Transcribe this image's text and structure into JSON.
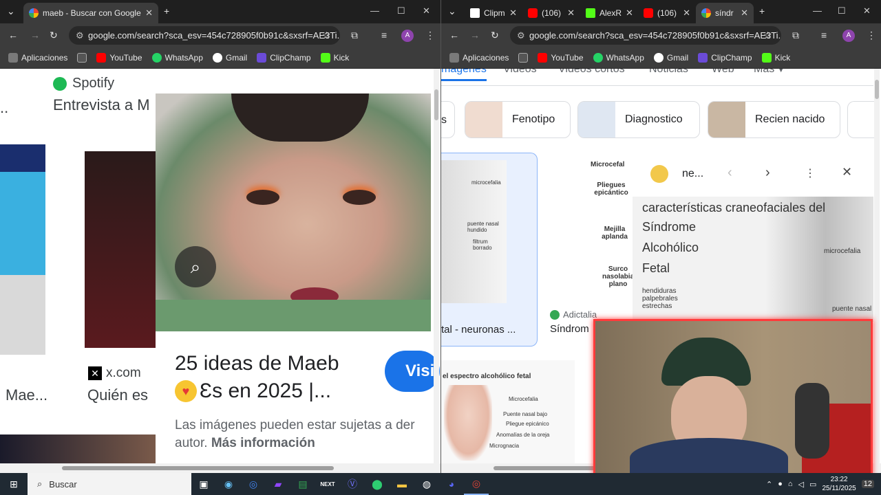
{
  "left_window": {
    "tab_title": "maeb - Buscar con Google",
    "url": "google.com/search?sca_esv=454c728905f0b91c&sxsrf=AE3Ti...",
    "bookmarks": [
      "Aplicaciones",
      "YouTube",
      "WhatsApp",
      "Gmail",
      "ClipChamp",
      "Kick"
    ],
    "spotify_label": "Spotify",
    "result_snippet": "Entrevista a M",
    "ellipsis": "..",
    "source_site": "x.com",
    "result_title_short": "Mae...",
    "result_title_2": "Quién es",
    "preview": {
      "title_line1": "25 ideas de Maeb",
      "title_line2": "Ɛs en 2025 |...",
      "visit_button": "Visi",
      "disclaimer": "Las imágenes pueden estar sujetas a der",
      "disclaimer_2": "autor.",
      "more_info": "Más información"
    }
  },
  "right_window": {
    "tabs": [
      {
        "label": "Clipm",
        "color": "#ffffff"
      },
      {
        "label": "(106)",
        "color": "#ff0000"
      },
      {
        "label": "AlexR",
        "color": "#53fc18"
      },
      {
        "label": "(106)",
        "color": "#ff0000"
      },
      {
        "label": "síndr",
        "color": "#4285f4"
      }
    ],
    "url": "google.com/search?sca_esv=454c728905f0b91c&sxsrf=AE3Ti...",
    "bookmarks": [
      "Aplicaciones",
      "YouTube",
      "WhatsApp",
      "Gmail",
      "ClipChamp",
      "Kick"
    ],
    "nav_tabs": [
      "mágenes",
      "Videos",
      "Videos cortos",
      "Noticias",
      "Web",
      "Más"
    ],
    "chips": [
      "s",
      "Fenotipo",
      "Diagnostico",
      "Recien nacido"
    ],
    "result1": {
      "caption": "tal - neuronas ...",
      "labels": [
        "microcefalia",
        "puente nasal hundido",
        "filtrum borrado"
      ]
    },
    "result2": {
      "source": "Adictalia",
      "caption": "Síndrom",
      "labels": [
        "Microcefal",
        "Pliegues epicántico",
        "Mejilla aplanda",
        "Surco nasolabia plano"
      ]
    },
    "result3": {
      "title": "el espectro alcohólico fetal",
      "labels": [
        "Microcefalia",
        "Puente nasal bajo",
        "Pliegue epicánico",
        "Anomalías de la oreja",
        "Micrognacia"
      ]
    },
    "viewer": {
      "site": "ne...",
      "heading": "características craneofaciales del",
      "words": [
        "Síndrome",
        "Alcohólico",
        "Fetal"
      ],
      "labels": [
        "microcefalia",
        "hendiduras palpebrales estrechas",
        "puente nasal"
      ]
    }
  },
  "taskbar": {
    "search": "Buscar",
    "time": "23:22",
    "date": "25/11/2025",
    "notifications": "12"
  }
}
